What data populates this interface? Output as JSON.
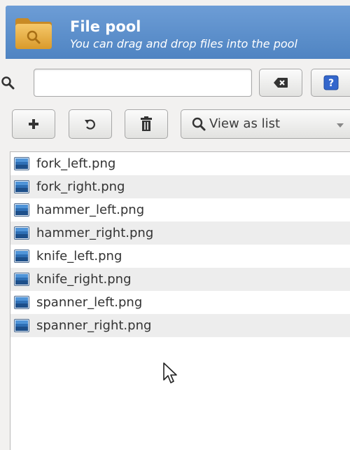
{
  "header": {
    "title": "File pool",
    "subtitle": "You can drag and drop files into the pool"
  },
  "search": {
    "value": "",
    "placeholder": ""
  },
  "toolbar": {
    "view_select_value": "View as list"
  },
  "icons": {
    "folder": "folder-icon",
    "search": "search-icon",
    "clear": "backspace-icon",
    "help": "help-icon",
    "add": "plus-icon",
    "undo": "undo-icon",
    "trash": "trash-icon",
    "dropdown": "chevron-down-icon",
    "file": "image-file-icon",
    "cursor": "mouse-pointer-icon"
  },
  "colors": {
    "header_bg": "#5a8dc8",
    "header_text": "#ffffff",
    "help_blue": "#3366cc",
    "file_icon_blue": "#2e6fb5"
  },
  "files": [
    "fork_left.png",
    "fork_right.png",
    "hammer_left.png",
    "hammer_right.png",
    "knife_left.png",
    "knife_right.png",
    "spanner_left.png",
    "spanner_right.png"
  ]
}
